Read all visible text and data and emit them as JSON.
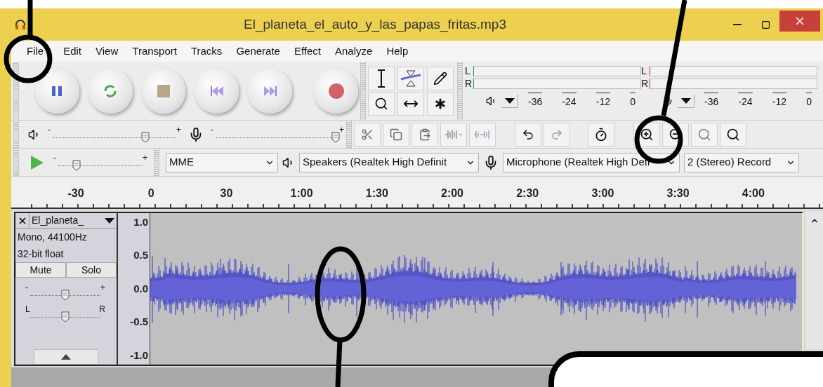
{
  "window": {
    "title": "El_planeta_el_auto_y_las_papas_fritas.mp3"
  },
  "menu": [
    "File",
    "Edit",
    "View",
    "Transport",
    "Tracks",
    "Generate",
    "Effect",
    "Analyze",
    "Help"
  ],
  "meters": [
    {
      "kind": "playback",
      "channels": [
        "L",
        "R"
      ],
      "ticks": [
        "-36",
        "-24",
        "-12",
        "0"
      ]
    },
    {
      "kind": "record",
      "channels": [
        "L",
        "R"
      ],
      "ticks": [
        "-36",
        "-24",
        "-12",
        "0"
      ]
    }
  ],
  "mixer": {
    "playback_volume": {
      "min_label": "-",
      "max_label": "+",
      "level": 0.75
    },
    "record_volume": {
      "min_label": "-",
      "max_label": "+",
      "level": 0.97
    }
  },
  "play_at_speed": {
    "min_label": "-",
    "max_label": "+",
    "level": 0.22
  },
  "device": {
    "host": "MME",
    "playback_device": "Speakers (Realtek High Definit",
    "recording_device": "Microphone (Realtek High Defi",
    "channels": "2 (Stereo) Record"
  },
  "ruler": [
    "-30",
    "0",
    "30",
    "1:00",
    "1:30",
    "2:00",
    "2:30",
    "3:00",
    "3:30",
    "4:00"
  ],
  "track": {
    "name": "El_planeta_",
    "info": [
      "Mono, 44100Hz",
      "32-bit float"
    ],
    "buttons": [
      "Mute",
      "Solo"
    ],
    "gain": {
      "min_label": "-",
      "max_label": "+",
      "level": 0.5
    },
    "pan": {
      "min_label": "L",
      "max_label": "R",
      "level": 0.5
    },
    "scale": [
      "1.0",
      "0.5",
      "0.0",
      "-0.5",
      "-1.0"
    ]
  }
}
